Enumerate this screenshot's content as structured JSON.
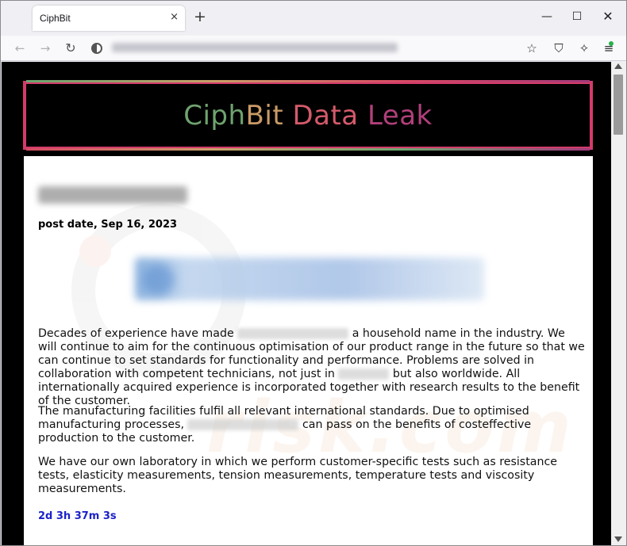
{
  "browser": {
    "tab_title": "CiphBit",
    "tab_close_icon": "×",
    "new_tab_icon": "+",
    "window_controls": {
      "minimize": "—",
      "maximize": "☐",
      "close": "✕"
    },
    "nav": {
      "back": "←",
      "forward": "→",
      "reload": "↻"
    },
    "toolbar": {
      "bookmark": "☆",
      "shield": "⛉",
      "extensions": "✧",
      "menu": "≡"
    }
  },
  "page": {
    "banner": {
      "part1": "Ciph",
      "part2": "Bit",
      "part3": " Data",
      "part4": " Leak"
    },
    "post_date": "post date, Sep 16, 2023",
    "paragraphs": {
      "p1_a": "Decades of experience have made ",
      "p1_b": " a household name in the industry. We will continue to aim for the continuous optimisation of our product range in the future so that we can continue to set standards for functionality and performance. Problems are solved in collaboration with competent technicians, not just in ",
      "p1_c": " but also worldwide. All internationally acquired experience is incorporated together with research results to the benefit of the customer.",
      "p2_a": "The manufacturing facilities fulfil all relevant international standards. Due to optimised manufacturing processes, ",
      "p2_b": " can pass on the benefits of costeffective production to the customer.",
      "p3": "We have our own laboratory in which we perform customer-specific tests such as resistance tests, elasticity measurements, tension measurements, temperature tests and viscosity measurements."
    },
    "countdown": "2d 3h 37m 3s"
  },
  "colors": {
    "banner_border": "#d33b6a",
    "countdown": "#1c22c8",
    "title_green": "#6fa36e",
    "title_orange": "#c99a66",
    "title_red": "#d35a6a",
    "title_purple": "#b0407a"
  }
}
